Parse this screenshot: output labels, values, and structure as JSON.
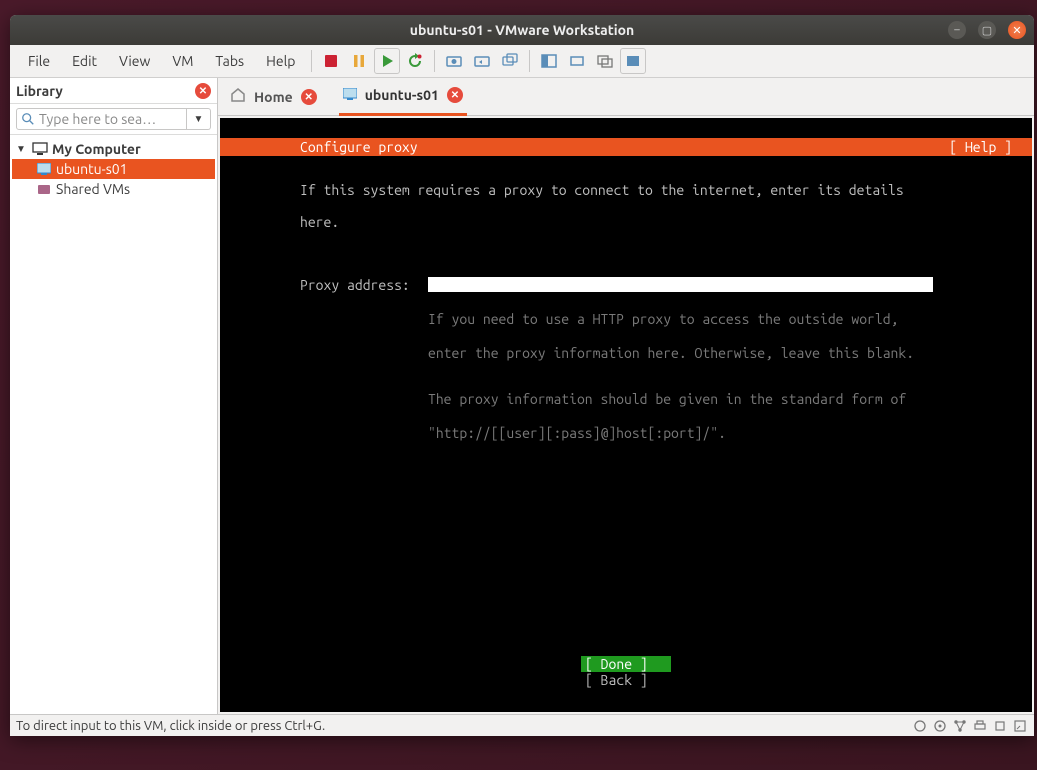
{
  "window": {
    "title": "ubuntu-s01 - VMware Workstation"
  },
  "menu": {
    "file": "File",
    "edit": "Edit",
    "view": "View",
    "vm": "VM",
    "tabs": "Tabs",
    "help": "Help"
  },
  "sidebar": {
    "title": "Library",
    "search_placeholder": "Type here to sea…",
    "items": [
      {
        "label": "My Computer"
      },
      {
        "label": "ubuntu-s01"
      },
      {
        "label": "Shared VMs"
      }
    ]
  },
  "tabs": {
    "home": "Home",
    "active": "ubuntu-s01"
  },
  "installer": {
    "heading": "Configure proxy",
    "help": "[ Help ]",
    "intro1": "If this system requires a proxy to connect to the internet, enter its details",
    "intro2": "here.",
    "field_label": "Proxy address:",
    "hint1": "If you need to use a HTTP proxy to access the outside world,",
    "hint2": "enter the proxy information here. Otherwise, leave this blank.",
    "hint3": "The proxy information should be given in the standard form of",
    "hint4": "\"http://[[user][:pass]@]host[:port]/\".",
    "done": "[ Done       ]",
    "back": "[ Back       ]"
  },
  "statusbar": {
    "hint": "To direct input to this VM, click inside or press Ctrl+G."
  }
}
